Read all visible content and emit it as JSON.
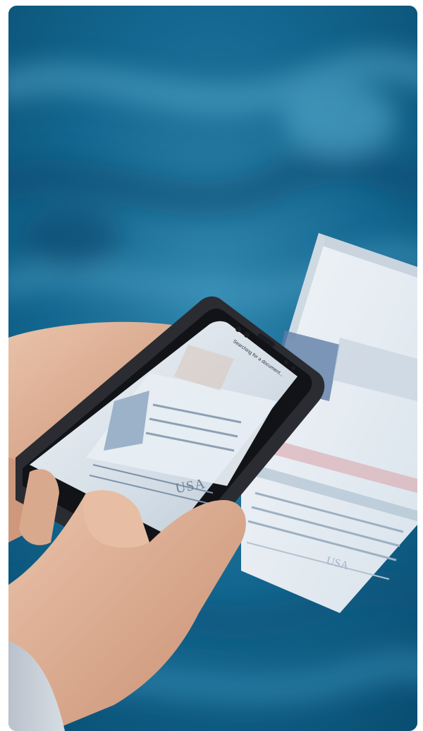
{
  "photo": {
    "scan_status": "Searching for a document...",
    "doc_country_code": "USA"
  },
  "colors": {
    "background": "#0e5e86",
    "background_light": "#2f86ad",
    "phone_case": "#2a2c31",
    "skin": "#e3b9a0",
    "passport_page": "#e4ecf2",
    "sleeve": "#c8ced6"
  }
}
